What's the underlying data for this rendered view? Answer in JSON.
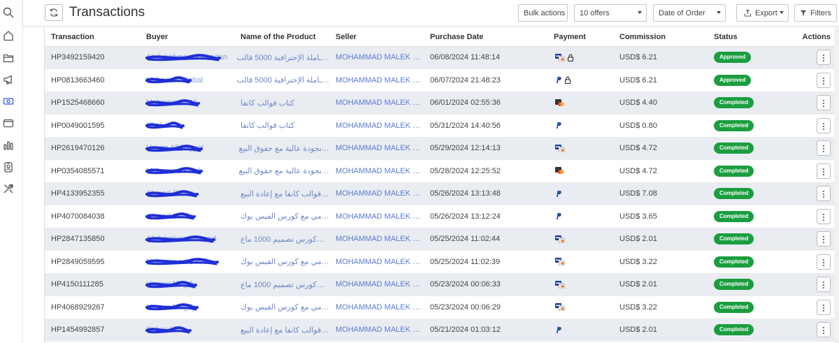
{
  "header": {
    "title": "Transactions",
    "bulk_actions": "Bulk actions",
    "offers_select": "10 offers",
    "order_select": "Date of Order",
    "export": "Export",
    "filters": "Filters"
  },
  "sidebar": {
    "icons": [
      "search-icon",
      "home-icon",
      "folder-icon",
      "megaphone-icon",
      "money-icon",
      "wallet-icon",
      "bar-chart-icon",
      "id-badge-icon",
      "tools-icon"
    ]
  },
  "table": {
    "columns": {
      "transaction": "Transaction",
      "buyer": "Buyer",
      "product": "Name of the Product",
      "seller": "Seller",
      "date": "Purchase Date",
      "payment": "Payment",
      "commission": "Commission",
      "status": "Status",
      "actions": "Actions"
    },
    "rows": [
      {
        "id": "HP3492159420",
        "buyer": "Abdulrahman Ramadan",
        "product": "…ـاملة الإحترافية 5000 قالب",
        "seller": "MOHAMMAD MALEK …",
        "date": "06/08/2024 11:48:14",
        "payment": "visa-card",
        "locked": true,
        "commission": "USD$ 6.21",
        "status": "Approved"
      },
      {
        "id": "HP0813663460",
        "buyer": "Mohamed Gabal",
        "product": "…ـاملة الإحترافية 5000 قالب",
        "seller": "MOHAMMAD MALEK …",
        "date": "06/07/2024 21:48:23",
        "payment": "paypal",
        "locked": true,
        "commission": "USD$ 6.21",
        "status": "Approved"
      },
      {
        "id": "HP1525468660",
        "buyer": "Mohammed Ali",
        "product": "كتاب قوالب كانفا",
        "seller": "MOHAMMAD MALEK …",
        "date": "06/01/2024 02:55:36",
        "payment": "mastercard",
        "locked": false,
        "commission": "USD$ 4.40",
        "status": "Completed"
      },
      {
        "id": "HP0049001595",
        "buyer": "Khalid",
        "product": "كتاب قوالب كانفا",
        "seller": "MOHAMMAD MALEK …",
        "date": "05/31/2024 14:40:56",
        "payment": "paypal",
        "locked": false,
        "commission": "USD$ 0.80",
        "status": "Completed"
      },
      {
        "id": "HP2619470126",
        "buyer": "Hasan Alkhayyat",
        "product": "…بجودة عالية مع حقوق البيع",
        "seller": "MOHAMMAD MALEK …",
        "date": "05/29/2024 12:14:13",
        "payment": "visa-card",
        "locked": false,
        "commission": "USD$ 4.72",
        "status": "Completed"
      },
      {
        "id": "HP0354085571",
        "buyer": "Mohamed Salah",
        "product": "…بجودة عالية مع حقوق البيع",
        "seller": "MOHAMMAD MALEK …",
        "date": "05/28/2024 12:25:52",
        "payment": "mastercard",
        "locked": false,
        "commission": "USD$ 4.72",
        "status": "Completed"
      },
      {
        "id": "HP4133952355",
        "buyer": "Ahmed Sahar",
        "product": "…قوالب كانفا مع إعادة البيع",
        "seller": "MOHAMMAD MALEK …",
        "date": "05/26/2024 13:13:48",
        "payment": "paypal",
        "locked": false,
        "commission": "USD$ 7.08",
        "status": "Completed"
      },
      {
        "id": "HP4070084038",
        "buyer": "Ahmed Samir",
        "product": "…مي مع كورس الفيس بوك",
        "seller": "MOHAMMAD MALEK …",
        "date": "05/26/2024 13:12:24",
        "payment": "paypal",
        "locked": false,
        "commission": "USD$ 3.65",
        "status": "Completed"
      },
      {
        "id": "HP2847135850",
        "buyer": "Abdulrahman Saeed",
        "product": "…كورس تصميم 1000 ماع",
        "seller": "MOHAMMAD MALEK …",
        "date": "05/25/2024 11:02:44",
        "payment": "visa-card",
        "locked": false,
        "commission": "USD$ 2.01",
        "status": "Completed"
      },
      {
        "id": "HP2849059595",
        "buyer": "Mohammed Saad",
        "product": "…مي مع كورس الفيس بوك",
        "seller": "MOHAMMAD MALEK …",
        "date": "05/25/2024 11:02:39",
        "payment": "visa-card",
        "locked": false,
        "commission": "USD$ 3.22",
        "status": "Completed"
      },
      {
        "id": "HP4150111285",
        "buyer": "Hazem Magdy",
        "product": "…كورس تصميم 1000 ماع",
        "seller": "MOHAMMAD MALEK …",
        "date": "05/23/2024 00:06:33",
        "payment": "visa-card",
        "locked": false,
        "commission": "USD$ 2.01",
        "status": "Completed"
      },
      {
        "id": "HP4068929267",
        "buyer": "Hazem Magdy",
        "product": "…مي مع كورس الفيس بوك",
        "seller": "MOHAMMAD MALEK …",
        "date": "05/23/2024 00:06:29",
        "payment": "visa-card",
        "locked": false,
        "commission": "USD$ 3.22",
        "status": "Completed"
      },
      {
        "id": "HP1454992857",
        "buyer": "Sahar Ali",
        "product": "…قوالب كانفا مع إعادة البيع",
        "seller": "MOHAMMAD MALEK …",
        "date": "05/21/2024 01:03:12",
        "payment": "paypal",
        "locked": false,
        "commission": "USD$ 2.01",
        "status": "Completed"
      }
    ]
  },
  "colors": {
    "status_green": "#1a9e3f",
    "link_blue": "#5a7bd0",
    "scribble_blue": "#1f2fd6",
    "row_stripe": "#e9ecf1"
  }
}
